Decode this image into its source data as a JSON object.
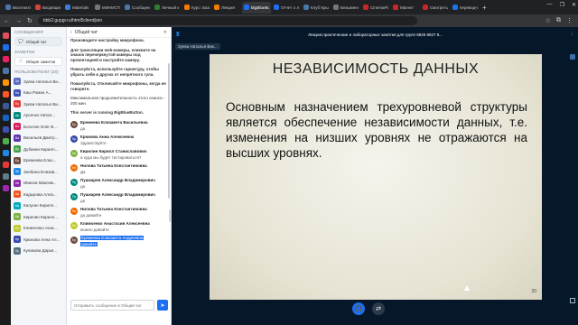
{
  "browser": {
    "tabs": [
      {
        "label": "Вконтакте",
        "color": "#4a76a8"
      },
      {
        "label": "Входящие",
        "color": "#d44638"
      },
      {
        "label": "Materials",
        "color": "#3b7dd8"
      },
      {
        "label": "МИНИСТЕ",
        "color": "#777"
      },
      {
        "label": "Сообщени",
        "color": "#4a76a8"
      },
      {
        "label": "Личный к",
        "color": "#2e7d32"
      },
      {
        "label": "Курс: Базы",
        "color": "#f57c00"
      },
      {
        "label": "Лекция",
        "color": "#f57c00"
      },
      {
        "label": "BigBlueButt",
        "color": "#1d6ff2",
        "active": true
      },
      {
        "label": "Отчет о ле",
        "color": "#1d6ff2"
      },
      {
        "label": "Клуб Крыл",
        "color": "#4a76a8"
      },
      {
        "label": "Безымянны",
        "color": "#777"
      },
      {
        "label": "CinemaPlay",
        "color": "#c62828"
      },
      {
        "label": "Магнит",
        "color": "#c62828"
      },
      {
        "label": "Смотреть",
        "color": "#c62828"
      },
      {
        "label": "переводчи",
        "color": "#1a73e8"
      }
    ],
    "new_tab": "+",
    "url": "bbb2.gupgr.ru/html5client/join",
    "window_controls": [
      "—",
      "❐",
      "✕"
    ]
  },
  "app_icons": [
    "#e04f5f",
    "#1d6ff2",
    "#e91e63",
    "#4a76a8",
    "#ff9800",
    "#ff5722",
    "#3b5998",
    "#1565c0",
    "#3f51b5",
    "#4caf50",
    "#1e88e5",
    "#e53935",
    "#607d8b",
    "#9c27b0"
  ],
  "users_panel": {
    "messages_header": "СООБЩЕНИЯ",
    "public_chat": "Общий чат",
    "notes_header": "ЗАМЕТКИ",
    "shared_notes": "Общие заметки",
    "users_header": "ПОЛЬЗОВАТЕЛИ (28)",
    "users": [
      {
        "initials": "Зн",
        "name": "Зуева Наталья Ви...",
        "color": "#5b6bc0"
      },
      {
        "initials": "Ка",
        "name": "Каш Роман А...",
        "color": "#3f51b5"
      },
      {
        "initials": "Бу",
        "name": "Зуева Наталья Ви...",
        "color": "#e53935"
      },
      {
        "initials": "Ар",
        "name": "Арсенко Натал...",
        "color": "#00897b"
      },
      {
        "initials": "Бо",
        "name": "Болотин Олег В...",
        "color": "#d81b60"
      },
      {
        "initials": "Ва",
        "name": "Васильев Дмитр...",
        "color": "#5e35b1"
      },
      {
        "initials": "Ду",
        "name": "Дубинин Кирилл...",
        "color": "#43a047"
      },
      {
        "initials": "Ер",
        "name": "Еремеева Елиз...",
        "color": "#6d4c41"
      },
      {
        "initials": "Зе",
        "name": "Зеебина Елизав...",
        "color": "#1e88e5"
      },
      {
        "initials": "Ив",
        "name": "Иванов Максим...",
        "color": "#8e24aa"
      },
      {
        "initials": "Ка",
        "name": "Кадырова Алла...",
        "color": "#f4511e"
      },
      {
        "initials": "Ка",
        "name": "Калугин Кирилл...",
        "color": "#00acc1"
      },
      {
        "initials": "Ки",
        "name": "Кирилин Кирилл...",
        "color": "#7cb342"
      },
      {
        "initials": "Кл",
        "name": "Климченко Анас...",
        "color": "#c0ca33"
      },
      {
        "initials": "Кр",
        "name": "Крюкова Анна Ал...",
        "color": "#3949ab"
      },
      {
        "initials": "Ку",
        "name": "Куликова Дарья...",
        "color": "#546e7a"
      }
    ]
  },
  "chat": {
    "title": "Общий чат",
    "close": "✕",
    "system_lines": [
      "Производите настройку микрофона.",
      "Для трансляции web-камеры, кликните на значок перечеркнутой камеры под презентацией и настройте камеру.",
      "Пожалуйста, используйте гарнитуру, чтобы убрать себя и других от непрятного гула.",
      "Пожалуйста, Отключайте микрофоны, когда не говорите."
    ],
    "duration_line": "Максимальная продолжительность этого сеанса - 200 мин.",
    "server_line": "This server is running BigBlueButton.",
    "messages": [
      {
        "initials": "Ер",
        "name": "Еремеева Елизавета Васильевна",
        "text": "да",
        "color": "#6d4c41"
      },
      {
        "initials": "Кр",
        "name": "Крюкова Анна Алексеевна",
        "text": "Здравствуйте",
        "color": "#3949ab"
      },
      {
        "initials": "Ки",
        "name": "Кирилин Кирилл Станиславович",
        "text": "а куда мы будет тестироваться?",
        "color": "#7cb342"
      },
      {
        "initials": "Ни",
        "name": "Нилова Татьяна Константиновна",
        "text": "Да",
        "color": "#ef6c00"
      },
      {
        "initials": "Пу",
        "name": "Пушкарев Александр Владимирович",
        "text": "да",
        "color": "#00897b"
      },
      {
        "initials": "Пу",
        "name": "Пушкарев Александр Владимирович",
        "text": "да",
        "color": "#00897b"
      },
      {
        "initials": "Ни",
        "name": "Нилова Татьяна Константиновна",
        "text": "да давайте",
        "color": "#ef6c00"
      },
      {
        "initials": "Кл",
        "name": "Климченко Анастасия Алексеевна",
        "text": "можно давайте",
        "color": "#c0ca33"
      },
      {
        "initials": "Ер",
        "name": "Еремеева Елизавета Андреевна",
        "text": "давайте",
        "color": "#6d4c41",
        "highlight": true
      }
    ],
    "input_placeholder": "Отправить сообщение в Общий чат",
    "send_icon": "➤"
  },
  "presenter": {
    "presenter_name": "Зуева Наталья Вик...",
    "session_title": "Лекция,практические и лабораторные занятия для групп 8826 8827 8...",
    "more": "⋮"
  },
  "slide": {
    "title": "НЕЗАВИСИМОСТЬ ДАННЫХ",
    "body": "Основным назначением трехуровневой структуры является обеспечение независимости данных, т.е. изменения на низших уровнях не отражаются на высших уровнях.",
    "page_number": "20"
  },
  "controls": {
    "audio_icon": "🎧",
    "screen_icon": "⇄"
  }
}
